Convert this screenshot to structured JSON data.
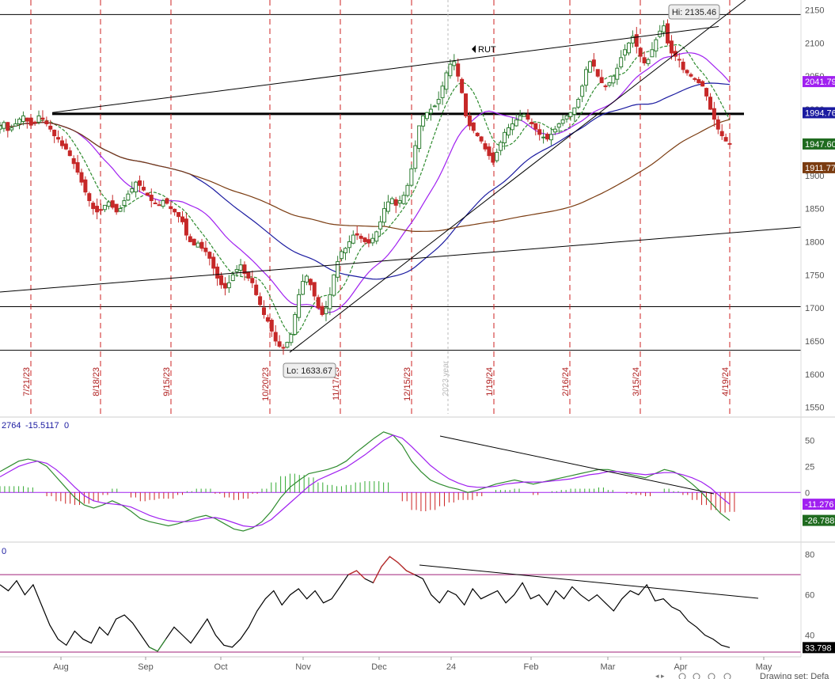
{
  "symbol": "RUT",
  "chart_data": [
    {
      "type": "candlestick",
      "panel": "price",
      "symbol": "RUT",
      "ylim": [
        1540,
        2165
      ],
      "y_ticks": [
        1550,
        1600,
        1650,
        1700,
        1750,
        1800,
        1850,
        1900,
        1950,
        2000,
        2050,
        2100,
        2150
      ],
      "x_labels": [
        "Aug",
        "Sep",
        "Oct",
        "Nov",
        "Dec",
        "24",
        "Feb",
        "Mar",
        "Apr",
        "May"
      ],
      "cycle_dates": [
        "7/21/23",
        "8/18/23",
        "9/15/23",
        "10/20/23",
        "11/17/23",
        "12/15/23",
        "1/19/24",
        "2/16/24",
        "3/15/24",
        "4/19/24"
      ],
      "year_marker": "2023 year",
      "annotations": {
        "high": "Hi: 2135.46",
        "low": "Lo: 1633.67"
      },
      "price_labels": [
        {
          "text": "2041.79",
          "value": 2041.79,
          "color": "#a020f0"
        },
        {
          "text": "1994.76",
          "value": 1994.76,
          "color": "#1a1aa0"
        },
        {
          "text": "1947.60",
          "value": 1947.6,
          "color": "#1f6b1f"
        },
        {
          "text": "1911.77",
          "value": 1911.77,
          "color": "#7a3b10"
        }
      ],
      "series": [
        {
          "name": "close",
          "values": [
            1975,
            1980,
            1968,
            1972,
            1978,
            1985,
            1990,
            1982,
            1976,
            1980,
            1990,
            1985,
            1978,
            1970,
            1960,
            1955,
            1945,
            1940,
            1930,
            1918,
            1905,
            1890,
            1875,
            1862,
            1850,
            1845,
            1848,
            1855,
            1860,
            1852,
            1845,
            1850,
            1862,
            1872,
            1880,
            1890,
            1885,
            1878,
            1870,
            1862,
            1858,
            1855,
            1862,
            1858,
            1850,
            1845,
            1838,
            1830,
            1810,
            1800,
            1795,
            1798,
            1790,
            1785,
            1775,
            1760,
            1745,
            1735,
            1730,
            1738,
            1750,
            1758,
            1765,
            1752,
            1745,
            1738,
            1720,
            1705,
            1690,
            1680,
            1665,
            1650,
            1642,
            1640,
            1648,
            1660,
            1690,
            1720,
            1740,
            1748,
            1735,
            1718,
            1700,
            1690,
            1700,
            1720,
            1750,
            1770,
            1785,
            1790,
            1800,
            1810,
            1810,
            1805,
            1800,
            1798,
            1805,
            1815,
            1830,
            1850,
            1860,
            1865,
            1855,
            1862,
            1870,
            1885,
            1910,
            1945,
            1975,
            1990,
            1995,
            2000,
            2005,
            2015,
            2035,
            2055,
            2068,
            2072,
            2050,
            2025,
            1990,
            1975,
            1968,
            1960,
            1952,
            1940,
            1930,
            1920,
            1935,
            1950,
            1965,
            1972,
            1978,
            1984,
            1990,
            1992,
            1985,
            1978,
            1970,
            1962,
            1958,
            1955,
            1962,
            1970,
            1978,
            1984,
            1990,
            1995,
            2002,
            2015,
            2035,
            2060,
            2072,
            2065,
            2050,
            2040,
            2035,
            2040,
            2050,
            2062,
            2078,
            2090,
            2100,
            2110,
            2095,
            2080,
            2070,
            2075,
            2090,
            2105,
            2118,
            2126,
            2100,
            2085,
            2080,
            2075,
            2060,
            2055,
            2050,
            2045,
            2040,
            2035,
            2020,
            2000,
            1985,
            1970,
            1960,
            1952,
            1947.6
          ]
        },
        {
          "name": "rising channel top",
          "values": []
        }
      ]
    },
    {
      "type": "line",
      "panel": "MACD",
      "header_values": [
        "2764",
        "-15.5117",
        "0"
      ],
      "y_ticks": [
        0,
        25,
        50
      ],
      "ylim": [
        -40,
        70
      ],
      "price_labels": [
        {
          "text": "-11.276",
          "value": -11.276,
          "color": "#a020f0"
        },
        {
          "text": "-26.788",
          "value": -26.788,
          "color": "#1f6b1f"
        }
      ],
      "series": [
        {
          "name": "",
          "color": "#2e8b2e",
          "values": [
            20,
            25,
            30,
            32,
            30,
            25,
            15,
            5,
            -5,
            -12,
            -15,
            -12,
            -8,
            -12,
            -18,
            -25,
            -28,
            -30,
            -32,
            -30,
            -27,
            -24,
            -22,
            -25,
            -30,
            -35,
            -37,
            -34,
            -28,
            -18,
            -5,
            5,
            12,
            18,
            20,
            22,
            25,
            30,
            38,
            45,
            52,
            58,
            55,
            45,
            30,
            20,
            12,
            8,
            5,
            3,
            0,
            2,
            5,
            8,
            10,
            12,
            10,
            8,
            10,
            12,
            14,
            16,
            18,
            20,
            22,
            22,
            20,
            18,
            16,
            14,
            18,
            22,
            20,
            15,
            8,
            0,
            -10,
            -20,
            -26.8
          ]
        },
        {
          "name": "",
          "color": "#a020f0",
          "values": [
            15,
            20,
            25,
            28,
            30,
            28,
            22,
            14,
            5,
            -3,
            -8,
            -10,
            -11,
            -12,
            -14,
            -18,
            -22,
            -25,
            -27,
            -28,
            -28,
            -27,
            -25,
            -24,
            -26,
            -29,
            -32,
            -33,
            -31,
            -26,
            -18,
            -10,
            -2,
            6,
            12,
            16,
            20,
            24,
            30,
            36,
            43,
            50,
            55,
            52,
            44,
            35,
            26,
            19,
            13,
            9,
            6,
            5,
            5,
            6,
            8,
            9,
            10,
            10,
            10,
            11,
            12,
            13,
            15,
            17,
            18,
            20,
            20,
            19,
            18,
            17,
            18,
            19,
            19,
            17,
            14,
            10,
            4,
            -4,
            -11.3
          ]
        },
        {
          "name": "",
          "color": "#aa0000",
          "values": []
        }
      ]
    },
    {
      "type": "line",
      "panel": "RSI",
      "header_values": [
        "0"
      ],
      "y_ticks": [
        40,
        60,
        80
      ],
      "ylim": [
        30,
        85
      ],
      "price_labels": [
        {
          "text": "33.798",
          "value": 33.798,
          "color": "#000000"
        }
      ],
      "series": [
        {
          "name": "",
          "color": "#000000",
          "values": [
            65,
            62,
            67,
            60,
            65,
            55,
            45,
            38,
            35,
            42,
            38,
            36,
            44,
            40,
            48,
            50,
            46,
            40,
            34,
            32,
            38,
            44,
            40,
            36,
            42,
            48,
            40,
            35,
            34,
            38,
            44,
            52,
            58,
            62,
            55,
            60,
            63,
            58,
            62,
            56,
            58,
            64,
            70,
            72,
            68,
            66,
            74,
            79,
            76,
            72,
            70,
            68,
            60,
            56,
            62,
            60,
            55,
            63,
            58,
            60,
            62,
            56,
            60,
            66,
            58,
            60,
            55,
            62,
            58,
            64,
            60,
            57,
            60,
            56,
            52,
            58,
            62,
            60,
            65,
            57,
            58,
            54,
            52,
            47,
            44,
            40,
            38,
            35,
            33.8
          ]
        }
      ]
    }
  ],
  "x_axis": {
    "labels": [
      "Aug",
      "Sep",
      "Oct",
      "Nov",
      "Dec",
      "24",
      "Feb",
      "Mar",
      "Apr",
      "May"
    ]
  },
  "footer": {
    "drawing_text": "Drawing set: Defa"
  }
}
